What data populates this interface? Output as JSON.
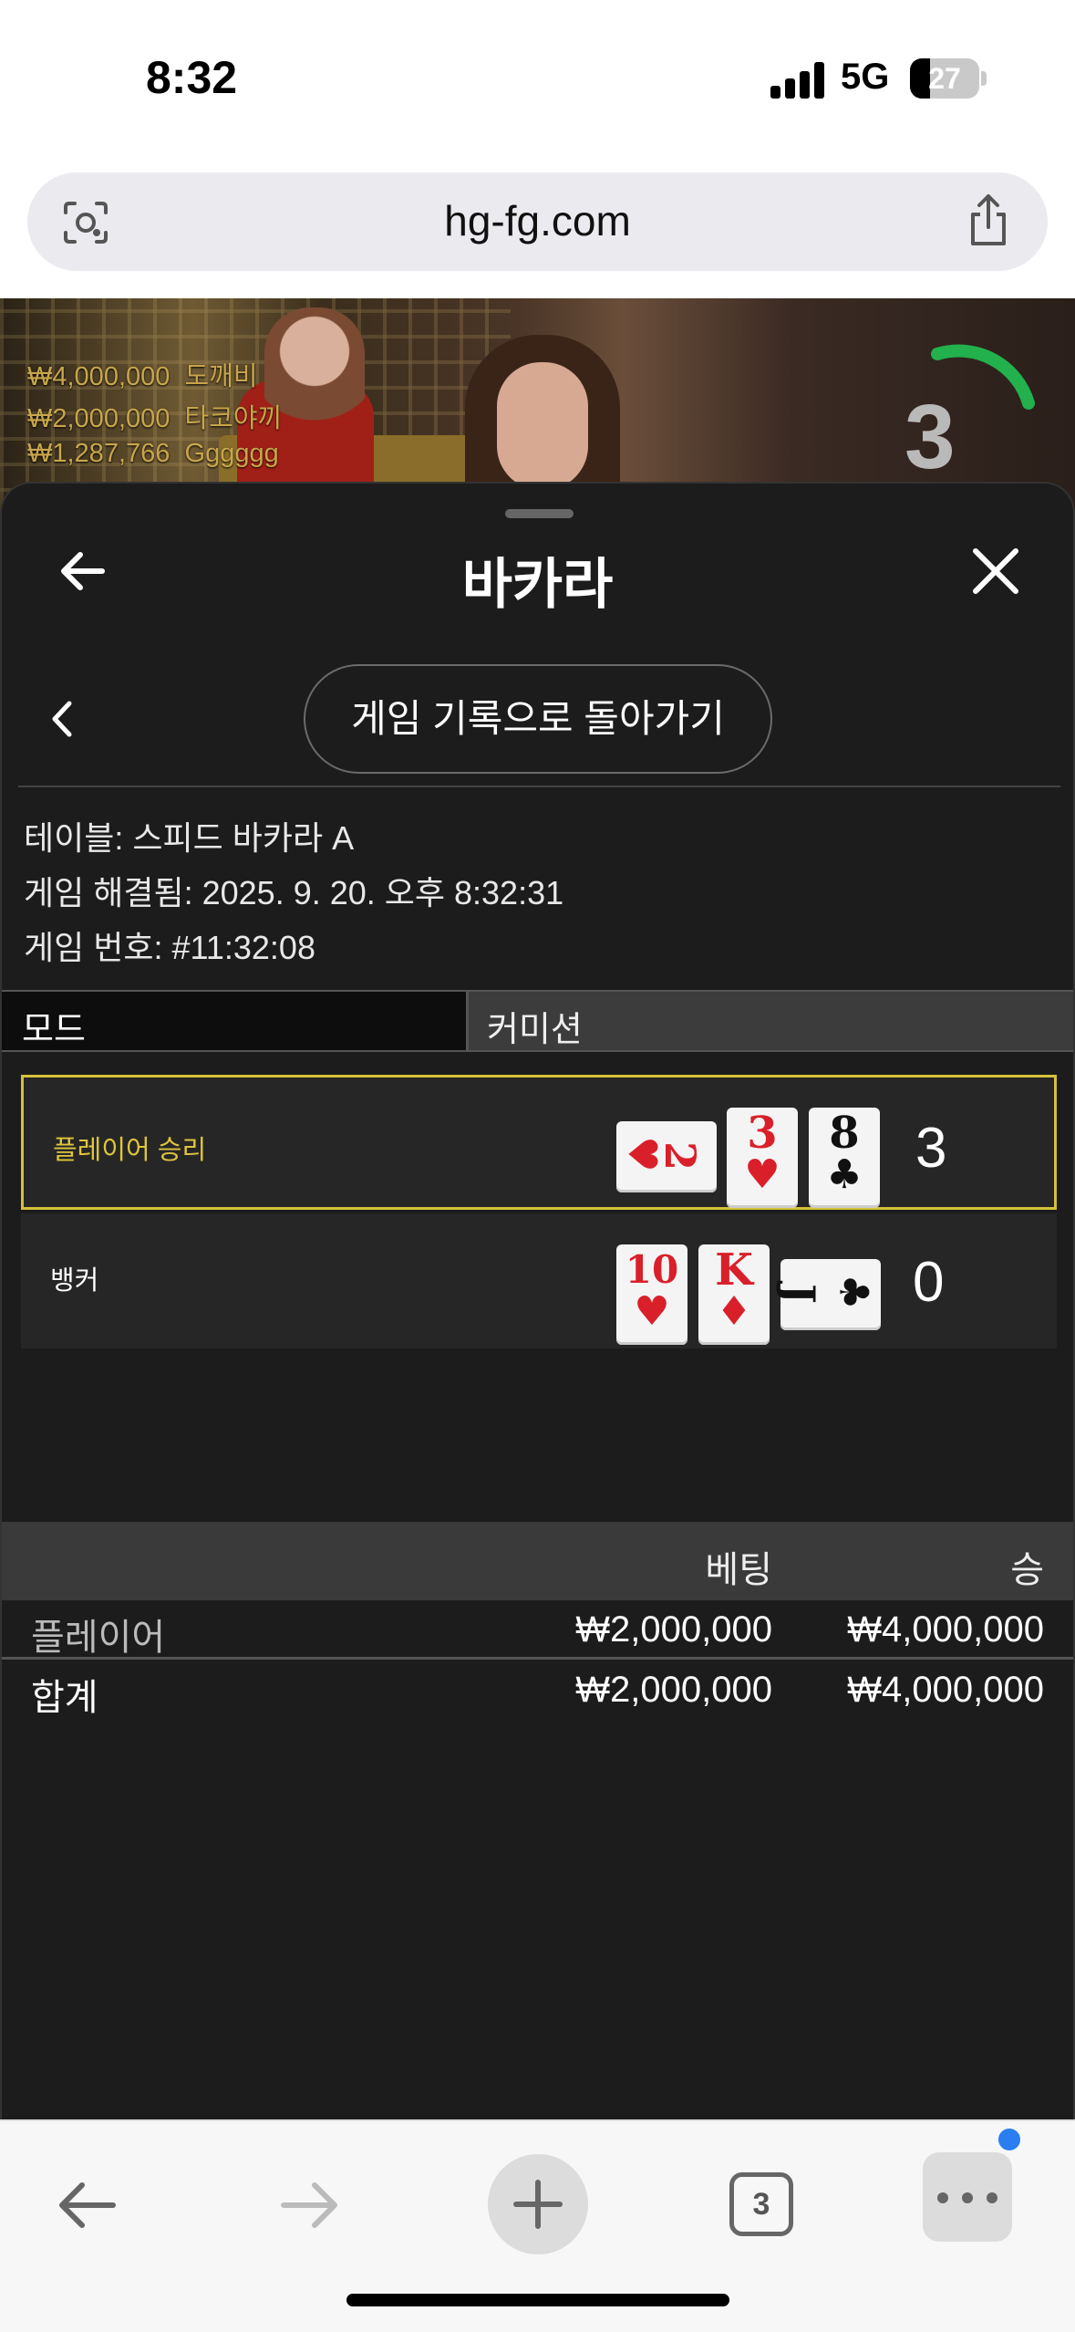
{
  "status_bar": {
    "time": "8:32",
    "network": "5G",
    "battery": "27"
  },
  "browser": {
    "url": "hg-fg.com",
    "tab_count": "3"
  },
  "video": {
    "bettors": [
      {
        "amount": "₩4,000,000",
        "name": "도깨비"
      },
      {
        "amount": "₩2,000,000",
        "name": "타코야끼"
      },
      {
        "amount": "₩1,287,766",
        "name": "Gggggg"
      }
    ],
    "countdown": "3"
  },
  "sheet": {
    "title": "바카라",
    "history_button": "게임 기록으로 돌아가기",
    "table_info": "테이블: 스피드 바카라 A",
    "resolved_info": "게임 해결됨: 2025. 9. 20. 오후 8:32:31",
    "game_number": "게임 번호: #11:32:08",
    "mode_label": "모드",
    "mode_value": "커미션"
  },
  "results": {
    "player": {
      "label": "플레이어 승리",
      "score": "3",
      "cards": [
        {
          "rank": "2",
          "suit": "♥",
          "color": "#d9202a",
          "sideways": true
        },
        {
          "rank": "3",
          "suit": "♥",
          "color": "#d9202a",
          "sideways": false
        },
        {
          "rank": "8",
          "suit": "♣",
          "color": "#111111",
          "sideways": false
        }
      ]
    },
    "banker": {
      "label": "뱅커",
      "score": "0",
      "cards": [
        {
          "rank": "10",
          "suit": "♥",
          "color": "#d9202a",
          "sideways": false
        },
        {
          "rank": "K",
          "suit": "♦",
          "color": "#d9202a",
          "sideways": false
        },
        {
          "rank": "J",
          "suit": "♣",
          "color": "#111111",
          "sideways": true
        }
      ]
    }
  },
  "bets": {
    "header_bet": "베팅",
    "header_win": "승",
    "rows": [
      {
        "label": "플레이어",
        "bet": "₩2,000,000",
        "win": "₩4,000,000"
      },
      {
        "label": "합계",
        "bet": "₩2,000,000",
        "win": "₩4,000,000"
      }
    ]
  },
  "colors": {
    "win_border": "#d4c13a",
    "win_text": "#e0c53c",
    "sheet_bg": "#1c1c1c"
  }
}
